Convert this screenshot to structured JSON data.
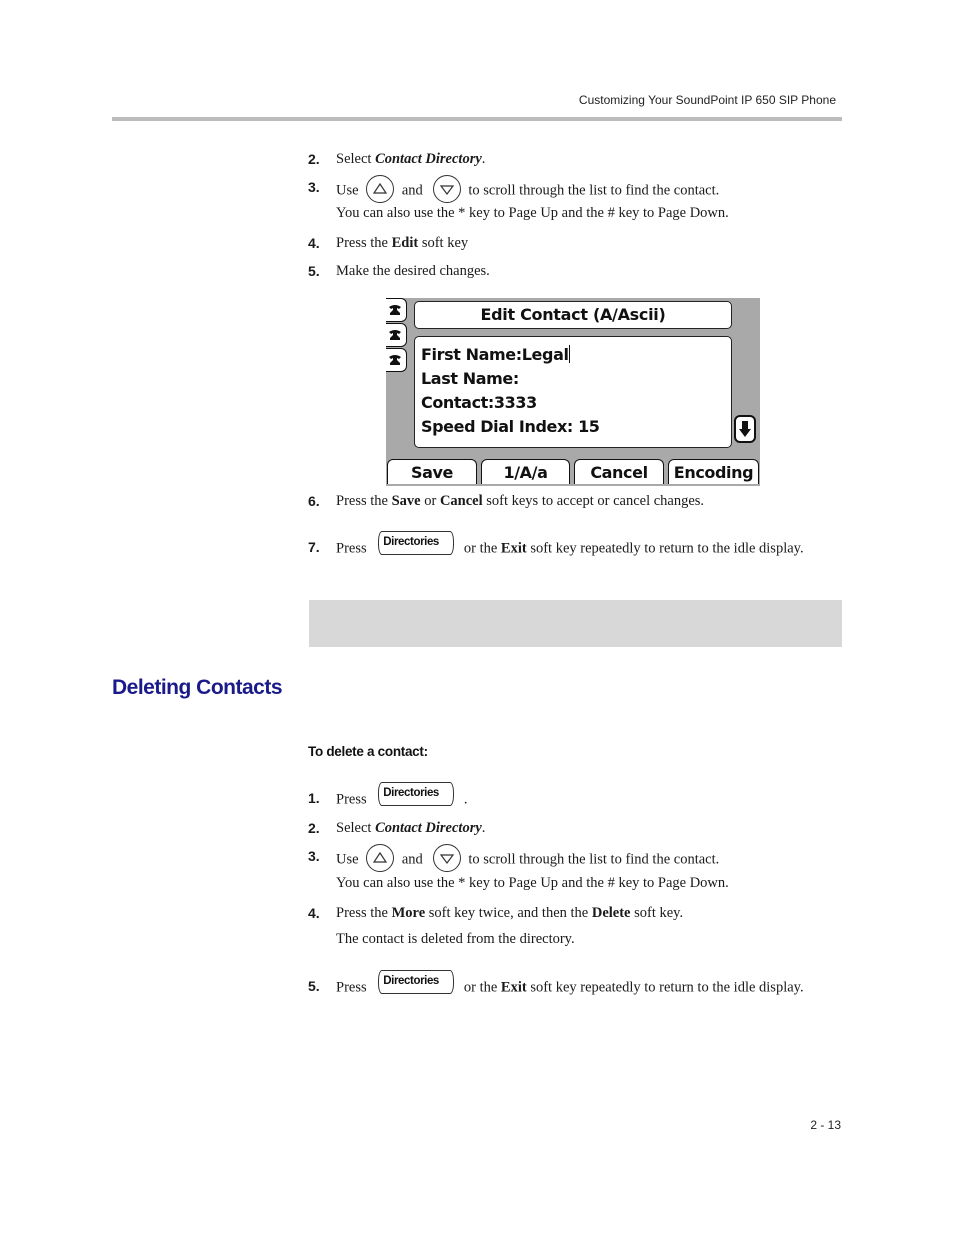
{
  "header": {
    "running_title": "Customizing Your SoundPoint IP 650 SIP Phone"
  },
  "edit_steps": [
    {
      "num": "2.",
      "parts": {
        "pre": "Select ",
        "em": "Contact Directory",
        "post": "."
      }
    },
    {
      "num": "3.",
      "parts": {
        "pre": "Use",
        "mid": "and",
        "post": "to scroll through the list to find the contact."
      },
      "note": "You can also use the * key to Page Up and the # key to Page Down."
    },
    {
      "num": "4.",
      "parts": {
        "pre": "Press the ",
        "bold": "Edit",
        "post": " soft key"
      }
    },
    {
      "num": "5.",
      "parts": {
        "text": "Make the desired changes."
      }
    },
    {
      "num": "6.",
      "parts": {
        "pre": "Press the ",
        "bold1": "Save",
        "mid": " or ",
        "bold2": "Cancel",
        "post": " soft keys to accept or cancel changes."
      }
    },
    {
      "num": "7.",
      "parts": {
        "pre": "Press",
        "key": "Directories",
        "mid": "or the ",
        "bold": "Exit",
        "post": " soft key repeatedly to return to the idle display."
      }
    }
  ],
  "phone_screen": {
    "title": "Edit Contact (A/Ascii)",
    "fields": [
      {
        "label": "First Name:",
        "value": "Legal"
      },
      {
        "label": "Last Name:",
        "value": ""
      },
      {
        "label": "Contact:",
        "value": "3333"
      },
      {
        "label": "Speed Dial Index:",
        "value": "15"
      }
    ],
    "softkeys": [
      "Save",
      "1/A/a",
      "Cancel",
      "Encoding"
    ],
    "line_keys": [
      "line-1",
      "line-2",
      "line-3"
    ],
    "scroll_indicator": "down-arrow"
  },
  "section": {
    "heading": "Deleting Contacts",
    "procedure_heading": "To delete a contact:"
  },
  "delete_steps": [
    {
      "num": "1.",
      "parts": {
        "pre": "Press",
        "key": "Directories",
        "post": "."
      }
    },
    {
      "num": "2.",
      "parts": {
        "pre": "Select ",
        "em": "Contact Directory",
        "post": "."
      }
    },
    {
      "num": "3.",
      "parts": {
        "pre": "Use",
        "mid": "and",
        "post": "to scroll through the list to find the contact."
      },
      "note": "You can also use the * key to Page Up and the # key to Page Down."
    },
    {
      "num": "4.",
      "parts": {
        "pre": "Press the ",
        "bold1": "More",
        "mid": " soft key twice, and then the ",
        "bold2": "Delete",
        "post": " soft key."
      },
      "note": "The contact is deleted from the directory."
    },
    {
      "num": "5.",
      "parts": {
        "pre": "Press",
        "key": "Directories",
        "mid": "or the ",
        "bold": "Exit",
        "post": " soft key repeatedly to return to the idle display."
      }
    }
  ],
  "icons": {
    "up_key": "up-arrow-key-icon",
    "down_key": "down-arrow-key-icon",
    "directories_key": "directories-key-icon"
  },
  "footer": {
    "page_number": "2 - 13"
  }
}
